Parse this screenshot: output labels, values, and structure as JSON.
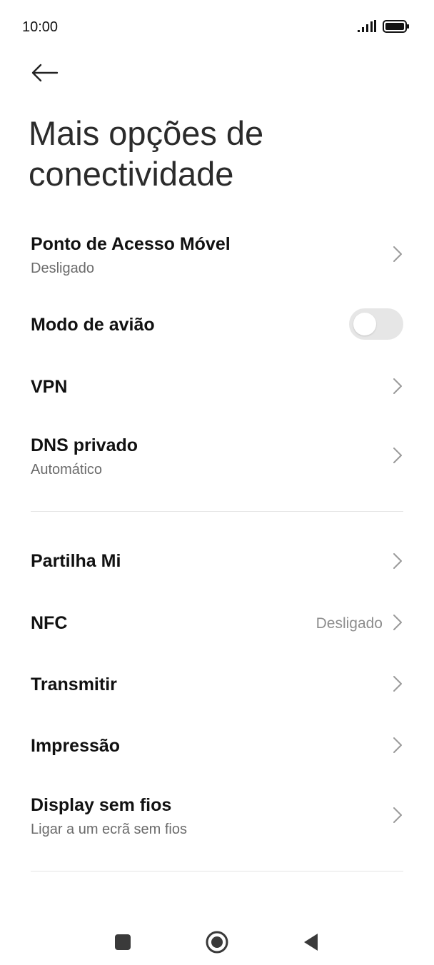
{
  "status_bar": {
    "time": "10:00",
    "signal_icon": "signal-bars-icon",
    "battery_icon": "battery-icon"
  },
  "header": {
    "back_icon": "arrow-left-icon",
    "title": "Mais opções de conectividade"
  },
  "settings": {
    "hotspot": {
      "title": "Ponto de Acesso Móvel",
      "subtitle": "Desligado"
    },
    "airplane": {
      "title": "Modo de avião",
      "enabled": false
    },
    "vpn": {
      "title": "VPN"
    },
    "private_dns": {
      "title": "DNS privado",
      "subtitle": "Automático"
    },
    "mi_share": {
      "title": "Partilha Mi"
    },
    "nfc": {
      "title": "NFC",
      "value": "Desligado"
    },
    "cast": {
      "title": "Transmitir"
    },
    "printing": {
      "title": "Impressão"
    },
    "wireless_display": {
      "title": "Display sem fios",
      "subtitle": "Ligar a um ecrã sem fios"
    }
  },
  "nav_bar": {
    "recents_icon": "square-icon",
    "home_icon": "circle-home-icon",
    "back_icon": "triangle-back-icon"
  },
  "colors": {
    "toggle_off": "#e6e6e6",
    "subtitle": "#6b6b6b",
    "chevron": "#9a9a9a"
  }
}
